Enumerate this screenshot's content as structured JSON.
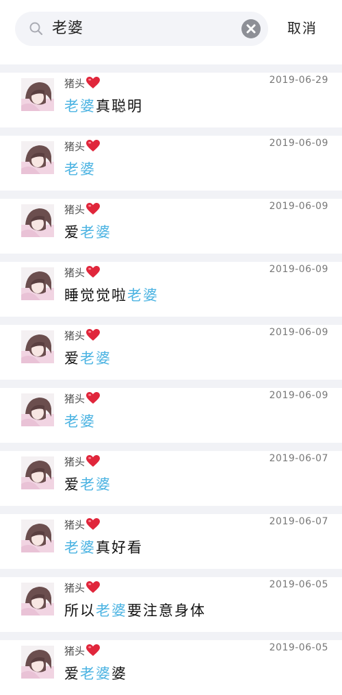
{
  "search": {
    "query": "老婆",
    "cancel_label": "取消"
  },
  "colors": {
    "highlight": "#4bb3e2",
    "search_bg": "#f3f4f8",
    "separator": "#f1f2f6"
  },
  "results": [
    {
      "sender": "猪头",
      "date": "2019-06-29",
      "before": "",
      "keyword": "老婆",
      "after": "真聪明"
    },
    {
      "sender": "猪头",
      "date": "2019-06-09",
      "before": "",
      "keyword": "老婆",
      "after": ""
    },
    {
      "sender": "猪头",
      "date": "2019-06-09",
      "before": "爱",
      "keyword": "老婆",
      "after": ""
    },
    {
      "sender": "猪头",
      "date": "2019-06-09",
      "before": "睡觉觉啦",
      "keyword": "老婆",
      "after": ""
    },
    {
      "sender": "猪头",
      "date": "2019-06-09",
      "before": "爱",
      "keyword": "老婆",
      "after": ""
    },
    {
      "sender": "猪头",
      "date": "2019-06-09",
      "before": "",
      "keyword": "老婆",
      "after": ""
    },
    {
      "sender": "猪头",
      "date": "2019-06-07",
      "before": "爱",
      "keyword": "老婆",
      "after": ""
    },
    {
      "sender": "猪头",
      "date": "2019-06-07",
      "before": "",
      "keyword": "老婆",
      "after": "真好看"
    },
    {
      "sender": "猪头",
      "date": "2019-06-05",
      "before": "所以",
      "keyword": "老婆",
      "after": "要注意身体"
    },
    {
      "sender": "猪头",
      "date": "2019-06-05",
      "before": "爱",
      "keyword": "老婆",
      "after": "婆"
    }
  ]
}
